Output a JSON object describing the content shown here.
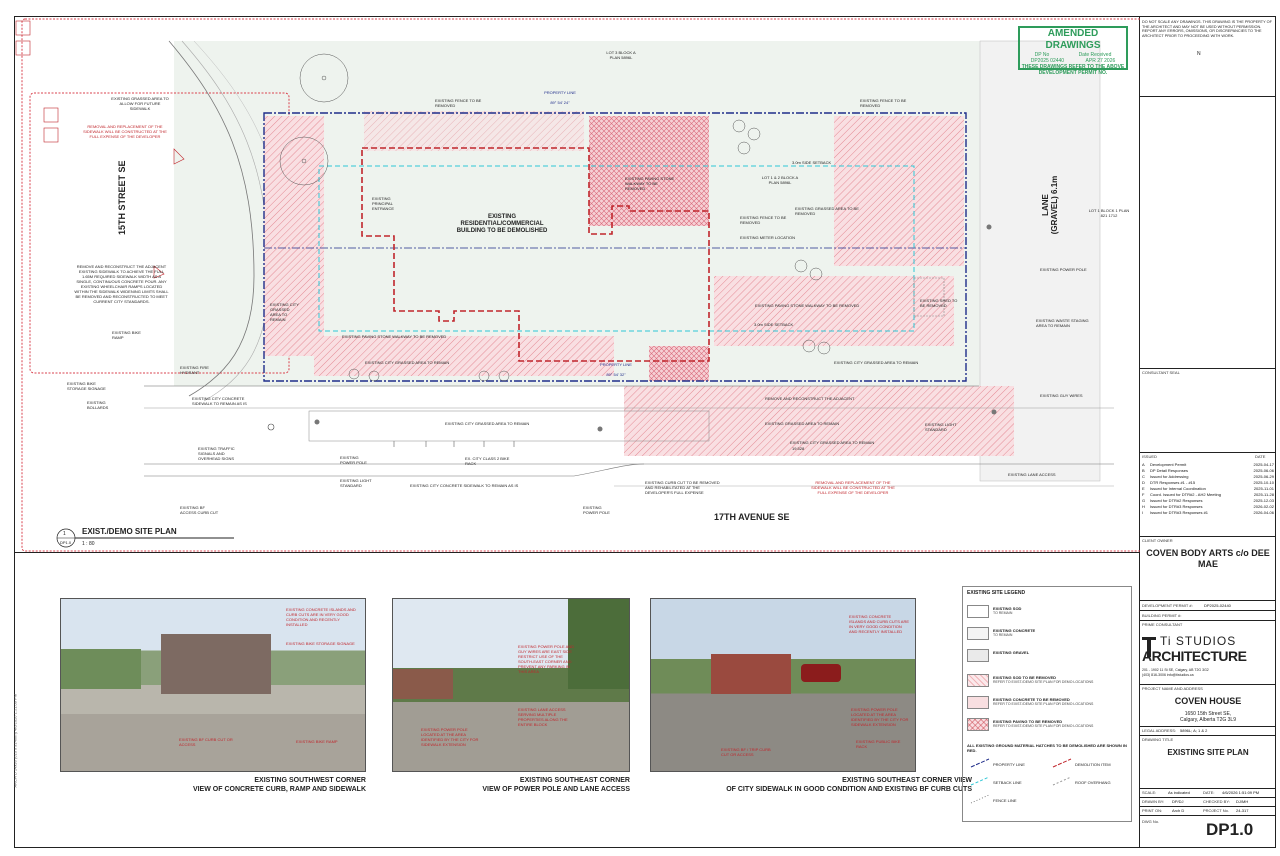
{
  "sheet": {
    "amended": {
      "title": "AMENDED DRAWINGS",
      "dp_label": "DP No",
      "dp_value": "DP2025 02440",
      "date_label": "Date Received",
      "date_value": "APR 27 2026",
      "note": "THESE DRAWINGS REFER TO THE ABOVE DEVELOPMENT PERMIT NO."
    },
    "disclaimer": "DO NOT SCALE ANY DRAWINGS. THIS DRAWING IS THE PROPERTY OF THE ARCHITECT AND MAY NOT BE USED WITHOUT PERMISSION. REPORT ANY ERRORS, OMISSIONS, OR DISCREPANCIES TO THE ARCHITECT PRIOR TO PROCEEDING WITH WORK.",
    "north": "N",
    "side_stamp": "ARCH D 24x36 (610 x 914mm) 4/6/2026 1:51:09 PM"
  },
  "plan": {
    "title": "EXIST./DEMO SITE PLAN",
    "number": "1",
    "sheet_ref": "DP1.0",
    "scale": "1 : 80",
    "street_left": "15TH STREET SE",
    "street_bottom": "17TH AVENUE SE",
    "lane": "LANE (GRAVEL) 6.1m",
    "building": "EXISTING RESIDENTIAL/COMMERCIAL BUILDING TO BE DEMOLISHED",
    "lot3": "LOT 3 BLOCK A PLAN 5896L",
    "lot12": "LOT 1 & 2 BLOCK A PLAN 5896L",
    "lot1": "LOT 1 BLOCK 1 PLAN 821 1712",
    "labels": [
      "EXISTING FENCE TO BE REMOVED",
      "EXISTING FENCE TO BE REMOVED",
      "EXISTING PAVING STONE WALKWAY TO BE REMOVED",
      "EXISTING GRASSED AREA TO BE REMOVED",
      "EXISTING FENCE TO BE REMOVED",
      "EXISTING METER LOCATION",
      "EXISTING PAVING STONE WALKWAY TO BE REMOVED",
      "EXISTING PAVING STONE WALKWAY TO BE REMOVED",
      "EXISTING CITY GRASSED AREA TO REMAIN",
      "EXISTING CITY GRASSED AREA TO REMAIN",
      "EXISTING POWER POLE",
      "EXISTING SHED TO BE REMOVED",
      "EXISTING WASTE STAGING AREA TO REMAIN",
      "EXISTING GUY WIRES",
      "REMOVE AND RECONSTRUCT THE ADJACENT",
      "EXISTING CITY GRASSED AREA TO REMAIN",
      "EXISTING GRASSED AREA TO REMAIN",
      "EXISTING CITY GRASSED AREA TO REMAIN",
      "EX. CITY CLASS 2 BIKE RACK",
      "EXISTING CITY CONCRETE SIDEWALK TO REMAIN AS IS",
      "EXISTING CITY CONCRETE SIDEWALK TO REMAIN AS IS",
      "EXISTING BOLLARDS",
      "EXISTING BIKE STORAGE SIGNAGE",
      "EXISTING TRAFFIC SIGNALS AND OVERHEAD SIGNS",
      "EXISTING POWER POLE",
      "EXISTING LIGHT STANDARD",
      "EXISTING LIGHT STANDARD",
      "EXISTING LANE ACCESS",
      "EXISTING BF ACCESS CURB CUT",
      "EXISTING CURB CUT TO BE REMOVED AND REHABILITATED AT THE DEVELOPER'S FULL EXPENSE",
      "EXISTING POWER POLE",
      "EXISTING BIKE RAMP",
      "EXISTING FIRE HYDRANT",
      "EXISTING GRASSED AREA TO ALLOW FOR FUTURE SIDEWALK",
      "EXISTING PRINCIPAL ENTRANCE",
      "EXISTING CITY GRASSED AREA TO REMAIN"
    ],
    "red_note_1": "REMOVAL AND REPLACEMENT OF THE SIDEWALK WILL BE CONSTRUCTED AT THE FULL EXPENSE OF THE DEVELOPER",
    "red_note_2": "REMOVAL AND REPLACEMENT OF THE SIDEWALK WILL BE CONSTRUCTED AT THE FULL EXPENSE OF THE DEVELOPER",
    "reconstruct_note": "REMOVE AND RECONSTRUCT THE ADJACENT EXISTING SIDEWALK TO ACHIEVE THE FULL 1.65M REQUIRED SIDEWALK WIDTH AS A SINGLE, CONTINUOUS CONCRETE POUR. ANY EXISTING WHEELCHAIR RAMPS LOCATED WITHIN THE SIDEWALK WIDENING LIMITS SHALL BE REMOVED AND RECONSTRUCTED TO MEET CURRENT CITY STANDARDS.",
    "property_line": "PROPERTY LINE",
    "setback_front": "3.0m SIDE SETBACK",
    "setback_rear": "3.0m SIDE SETBACK",
    "setback_side": "3.0m REAR SETBACK",
    "bearing1": "89° 54' 24\"",
    "bearing2": "89° 54' 32\"",
    "dim": "19.528"
  },
  "photos": [
    {
      "caption_1": "EXISTING SOUTHWEST CORNER",
      "caption_2": "VIEW OF CONCRETE CURB, RAMP AND SIDEWALK",
      "notes": [
        "EXISTING CONCRETE ISLANDS AND CURB CUTS ARE IN VERY GOOD CONDITION AND RECENTLY INSTALLED",
        "EXISTING BIKE STORAGE SIGNAGE",
        "EXISTING BF CURB CUT OR ACCESS",
        "EXISTING BIKE RAMP"
      ]
    },
    {
      "caption_1": "EXISTING SOUTHEAST CORNER",
      "caption_2": "VIEW OF POWER POLE AND LANE ACCESS",
      "notes": [
        "EXISTING POWER POLE AND GUY WIRES ARE EAST SIDE RESTRICT USE OF THE SOUTH-EAST CORNER AND PREVENT ANY PARKING IN THIS AREA",
        "EXISTING LANE ACCESS SERVING MULTIPLE PROPERTIES ALONG THE ENTIRE BLOCK",
        "EXISTING POWER POLE LOCATED AT THE AREA IDENTIFIED BY THE CITY FOR SIDEWALK EXTENSION"
      ]
    },
    {
      "caption_1": "EXISTING SOUTHEAST CORNER VIEW",
      "caption_2": "OF CITY SIDEWALK IN GOOD CONDITION AND EXISTING BF CURB CUTS",
      "notes": [
        "EXISTING CONCRETE ISLANDS AND CURB CUTS ARE IN VERY GOOD CONDITION AND RECENTLY INSTALLED",
        "EXISTING POWER POLE LOCATED AT THE AREA IDENTIFIED BY THE CITY FOR SIDEWALK EXTENSION",
        "EXISTING PUBLIC BIKE RACK",
        "EXISTING BF / TRIP CURB CUT OR ACCESS"
      ]
    }
  ],
  "legend": {
    "title": "EXISTING SITE LEGEND",
    "items": [
      {
        "label": "EXISTING SOD",
        "sub": "TO REMAIN"
      },
      {
        "label": "EXISTING CONCRETE",
        "sub": "TO REMAIN"
      },
      {
        "label": "EXISTING GRAVEL",
        "sub": ""
      },
      {
        "label": "EXISTING SOD TO BE REMOVED",
        "sub": "REFER TO EXIST./DEMO SITE PLAN FOR DEMO LOCATIONS"
      },
      {
        "label": "EXISTING CONCRETE TO BE REMOVED",
        "sub": "REFER TO EXIST./DEMO SITE PLAN FOR DEMO LOCATIONS"
      },
      {
        "label": "EXISTING PAVING TO BE REMOVED",
        "sub": "REFER TO EXIST./DEMO SITE PLAN FOR DEMO LOCATIONS"
      }
    ],
    "note": "ALL EXISTING GROUND MATERIAL HATCHES TO BE DEMOLISHED ARE SHOWN IN RED.",
    "lines": [
      {
        "label": "PROPERTY LINE"
      },
      {
        "label": "DEMOLITION ITEM"
      },
      {
        "label": "SETBACK LINE"
      },
      {
        "label": "ROOF OVERHANG"
      },
      {
        "label": "FENCE LINE"
      }
    ]
  },
  "titleblock": {
    "consultant_seal": "CONSULTANT SEAL",
    "issued_label": "ISSUED",
    "date_label": "DATE",
    "issues": [
      {
        "id": "A",
        "desc": "Development Permit",
        "date": "2025-04-17"
      },
      {
        "id": "B",
        "desc": "DP Detail Responses",
        "date": "2025-06-06"
      },
      {
        "id": "C",
        "desc": "Issued for Addressing",
        "date": "2025-06-29"
      },
      {
        "id": "D",
        "desc": "DTR Responses #1 - #15",
        "date": "2025-10-10"
      },
      {
        "id": "E",
        "desc": "Issued for Internal Coordination",
        "date": "2025-11-01"
      },
      {
        "id": "F",
        "desc": "Coord. Issued for DTR#2 - AH2 Meeting",
        "date": "2025-11-28"
      },
      {
        "id": "G",
        "desc": "Issued for DTR#2 Responses",
        "date": "2025-12-03"
      },
      {
        "id": "H",
        "desc": "Issued for DTR#3 Responses",
        "date": "2026-02-02"
      },
      {
        "id": "I",
        "desc": "Issued for DTR#3 Responses #1",
        "date": "2026-04-06"
      }
    ],
    "client_label": "CLIENT OWNER",
    "client": "COVEN BODY ARTS c/o DEE MAE",
    "dp_label": "DEVELOPMENT PERMIT #:",
    "dp_value": "DP2025-02440",
    "bp_label": "BUILDING PERMIT #:",
    "prime_label": "PRIME CONSULTANT",
    "firm_1": "Ti STUDIOS",
    "firm_2": "ARCHITECTURE",
    "firm_addr": "201 - 1902 11 St SE, Calgary, AB T2G 3G2",
    "firm_contact": "(403) 816-3006     info@tistudios.ca",
    "project_label": "PROJECT NAME AND ADDRESS",
    "project": "COVEN HOUSE",
    "address_1": "1650 15th Street SE,",
    "address_2": "Calgary, Alberta T2G 3L9",
    "legal_label": "LEGAL ADDRESS:",
    "legal": "5896L; A; 1 & 2",
    "drawing_title_label": "DRAWING TITLE",
    "drawing_title": "EXISTING SITE PLAN",
    "scale_label": "SCALE:",
    "scale": "As indicated",
    "date_l": "DATE:",
    "date": "4/6/2026 1:51:09 PM",
    "drawn_label": "DRAWN BY:",
    "drawn": "DP/DJ",
    "checked_label": "CHECKED BY:",
    "checked": "DJ/MH",
    "print_label": "PRINT ON:",
    "print": "Arch D",
    "projno_label": "PROJECT No.",
    "projno": "24-317",
    "dwg_label": "DWG No.",
    "dwg": "DP1.0"
  },
  "colors": {
    "property_line": "#1f2d8a",
    "demolition": "#c0262c",
    "setback": "#2ec7d6",
    "amended": "#2e9c5b"
  }
}
